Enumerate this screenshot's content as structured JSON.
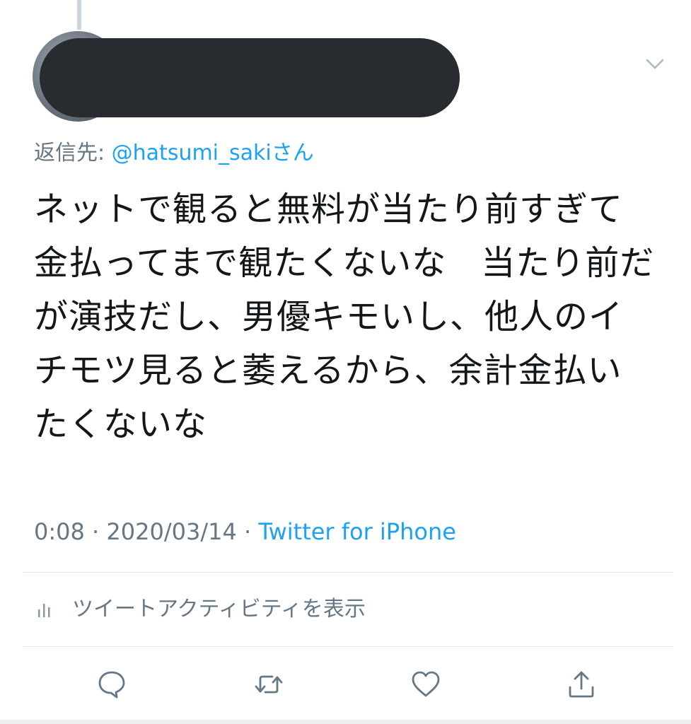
{
  "tweet": {
    "reply_prefix": "返信先: ",
    "reply_handle": "@hatsumi_sakiさん",
    "text": "ネットで観ると無料が当たり前すぎて金払ってまで観たくないな　当たり前だが演技だし、男優キモいし、他人のイチモツ見ると萎えるから、余計金払いたくないな",
    "time": "0:08",
    "separator": " · ",
    "date": "2020/03/14",
    "source": "Twitter for iPhone"
  },
  "activity": {
    "label": "ツイートアクティビティを表示",
    "icon": "bar-chart-icon"
  },
  "actions": {
    "icons": [
      "reply-icon",
      "retweet-icon",
      "like-icon",
      "share-icon"
    ]
  },
  "colors": {
    "text": "#14171a",
    "secondary": "#657786",
    "accent": "#1da1f2",
    "divider": "#e1e8ed"
  }
}
